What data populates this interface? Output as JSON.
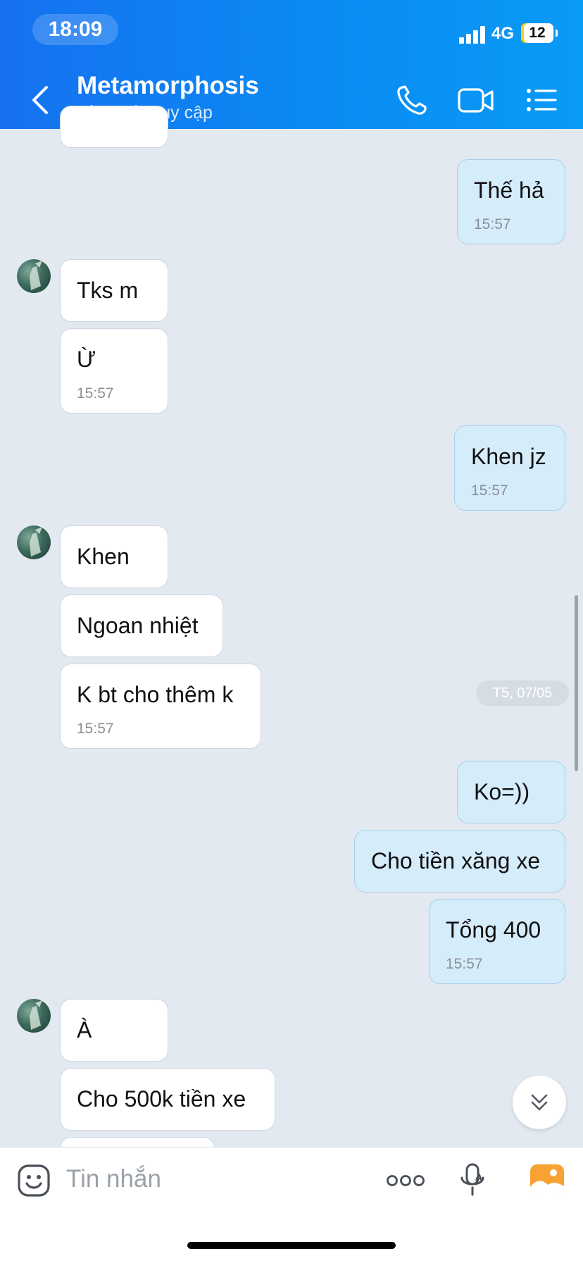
{
  "status_bar": {
    "time": "18:09",
    "network": "4G",
    "battery": "12"
  },
  "header": {
    "title": "Metamorphosis",
    "subtitle": "Vừa mới truy cập"
  },
  "messages": [
    {
      "text": "Thế hả",
      "time": "15:57",
      "side": "out"
    },
    {
      "text": "Tks m",
      "time": "",
      "side": "in"
    },
    {
      "text": "Ừ",
      "time": "15:57",
      "side": "in"
    },
    {
      "text": "Khen jz",
      "time": "15:57",
      "side": "out"
    },
    {
      "text": "Khen",
      "time": "",
      "side": "in"
    },
    {
      "text": "Ngoan nhiệt",
      "time": "",
      "side": "in"
    },
    {
      "text": "K bt cho thêm k",
      "time": "15:57",
      "side": "in"
    },
    {
      "text": "Ko=))",
      "time": "",
      "side": "out"
    },
    {
      "text": "Cho tiền xăng xe",
      "time": "",
      "side": "out"
    },
    {
      "text": "Tổng 400",
      "time": "15:57",
      "side": "out"
    },
    {
      "text": "À",
      "time": "",
      "side": "in"
    },
    {
      "text": "Cho 500k tiền xe",
      "time": "",
      "side": "in"
    }
  ],
  "date_badge": "T5, 07/05",
  "composer": {
    "placeholder": "Tin nhắn"
  },
  "icons": {
    "back": "chevron-left-icon",
    "call": "phone-icon",
    "video": "video-camera-icon",
    "menu": "list-menu-icon",
    "emoji": "emoji-icon",
    "more": "more-dots-icon",
    "mic": "microphone-icon",
    "image": "image-icon",
    "scroll": "double-chevron-down-icon"
  },
  "colors": {
    "header": "#0a8bf3",
    "outgoing_bubble": "#d5ecfb",
    "incoming_bubble": "#ffffff",
    "background": "#e2e9f1",
    "accent_image": "#f7a233"
  }
}
